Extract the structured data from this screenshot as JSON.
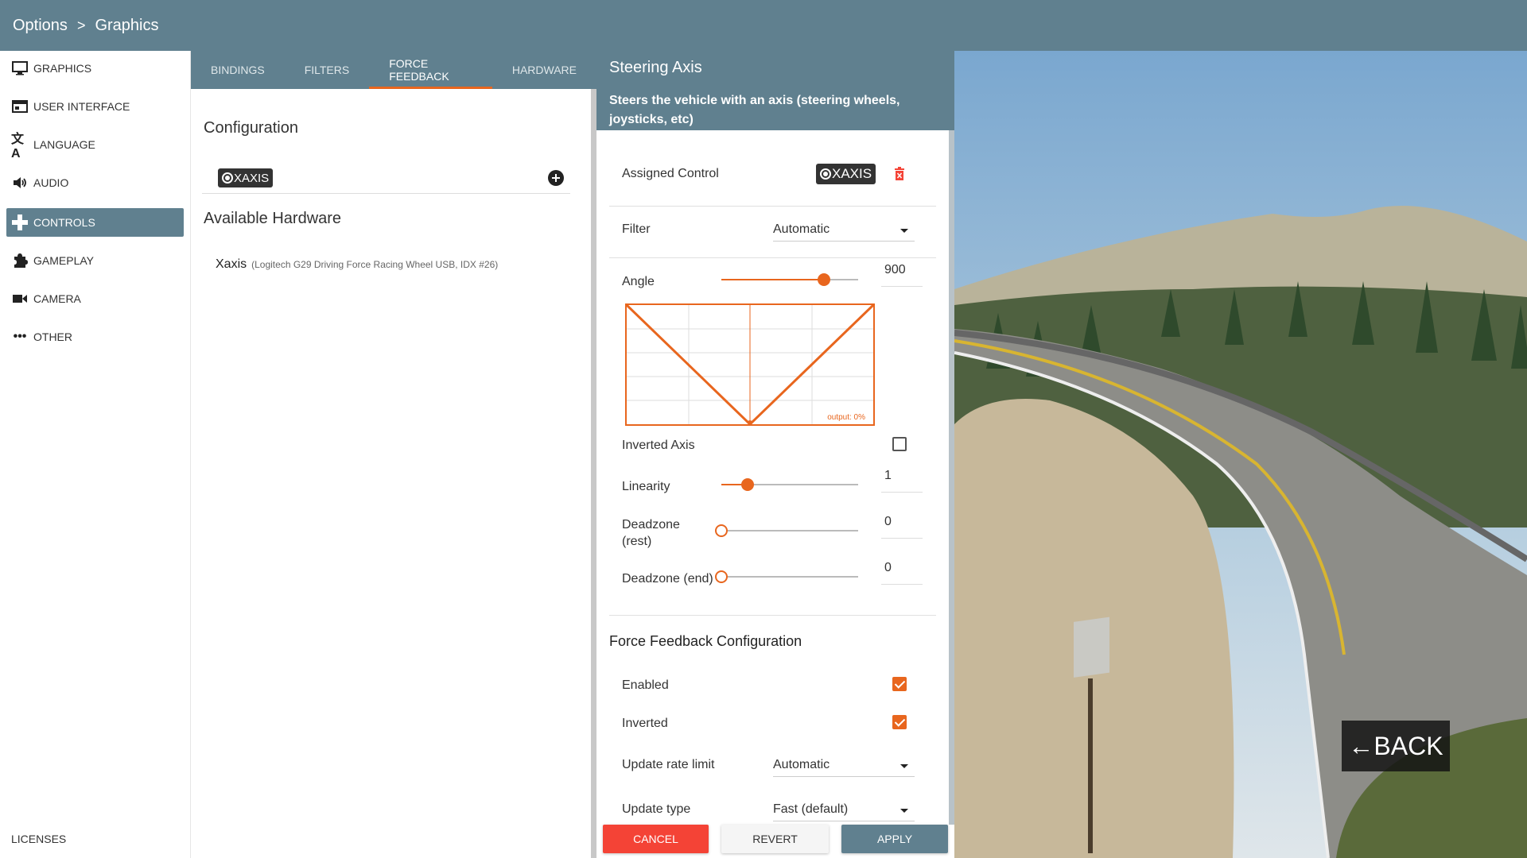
{
  "header": {
    "root": "Options",
    "separator": ">",
    "current": "Graphics"
  },
  "sidebar": {
    "items": [
      {
        "label": "GRAPHICS",
        "icon": "monitor-icon"
      },
      {
        "label": "USER INTERFACE",
        "icon": "window-icon"
      },
      {
        "label": "LANGUAGE",
        "icon": "translate-icon"
      },
      {
        "label": "AUDIO",
        "icon": "speaker-icon"
      },
      {
        "label": "CONTROLS",
        "icon": "gamepad-icon",
        "active": true
      },
      {
        "label": "GAMEPLAY",
        "icon": "puzzle-icon"
      },
      {
        "label": "CAMERA",
        "icon": "videocam-icon"
      },
      {
        "label": "OTHER",
        "icon": "more-icon"
      }
    ],
    "licenses": "LICENSES"
  },
  "tabs": [
    {
      "label": "BINDINGS"
    },
    {
      "label": "FILTERS"
    },
    {
      "label": "FORCE FEEDBACK",
      "active": true
    },
    {
      "label": "HARDWARE"
    }
  ],
  "middle": {
    "configuration_title": "Configuration",
    "config_binding": "XAXIS",
    "available_hardware_title": "Available Hardware",
    "hardware": {
      "axis": "Xaxis",
      "device": "(Logitech G29 Driving Force Racing Wheel USB, IDX #26)"
    }
  },
  "detail": {
    "title": "Steering Axis",
    "subtitle": "Steers the vehicle with an axis (steering wheels, joysticks, etc)",
    "assigned_control_label": "Assigned Control",
    "assigned_control_value": "XAXIS",
    "filter_label": "Filter",
    "filter_value": "Automatic",
    "angle_label": "Angle",
    "angle_value": "900",
    "angle_level": 0.75,
    "graph_output_label": "output: 0%",
    "inverted_axis_label": "Inverted Axis",
    "inverted_axis_checked": false,
    "linearity_label": "Linearity",
    "linearity_value": "1",
    "linearity_level": 0.19,
    "deadzone_rest_label_1": "Deadzone",
    "deadzone_rest_label_2": "(rest)",
    "deadzone_rest_value": "0",
    "deadzone_end_label": "Deadzone (end)",
    "deadzone_end_value": "0",
    "ffb_title": "Force Feedback Configuration",
    "enabled_label": "Enabled",
    "enabled_checked": true,
    "inverted_label": "Inverted",
    "inverted_checked": true,
    "update_rate_label": "Update rate limit",
    "update_rate_value": "Automatic",
    "update_type_label": "Update type",
    "update_type_value": "Fast (default)"
  },
  "buttons": {
    "cancel": "CANCEL",
    "revert": "REVERT",
    "apply": "APPLY"
  },
  "back_button": {
    "arrow": "←",
    "label": "BACK"
  },
  "colors": {
    "header": "#60808f",
    "accent": "#e8661e",
    "cancel": "#f44336"
  }
}
